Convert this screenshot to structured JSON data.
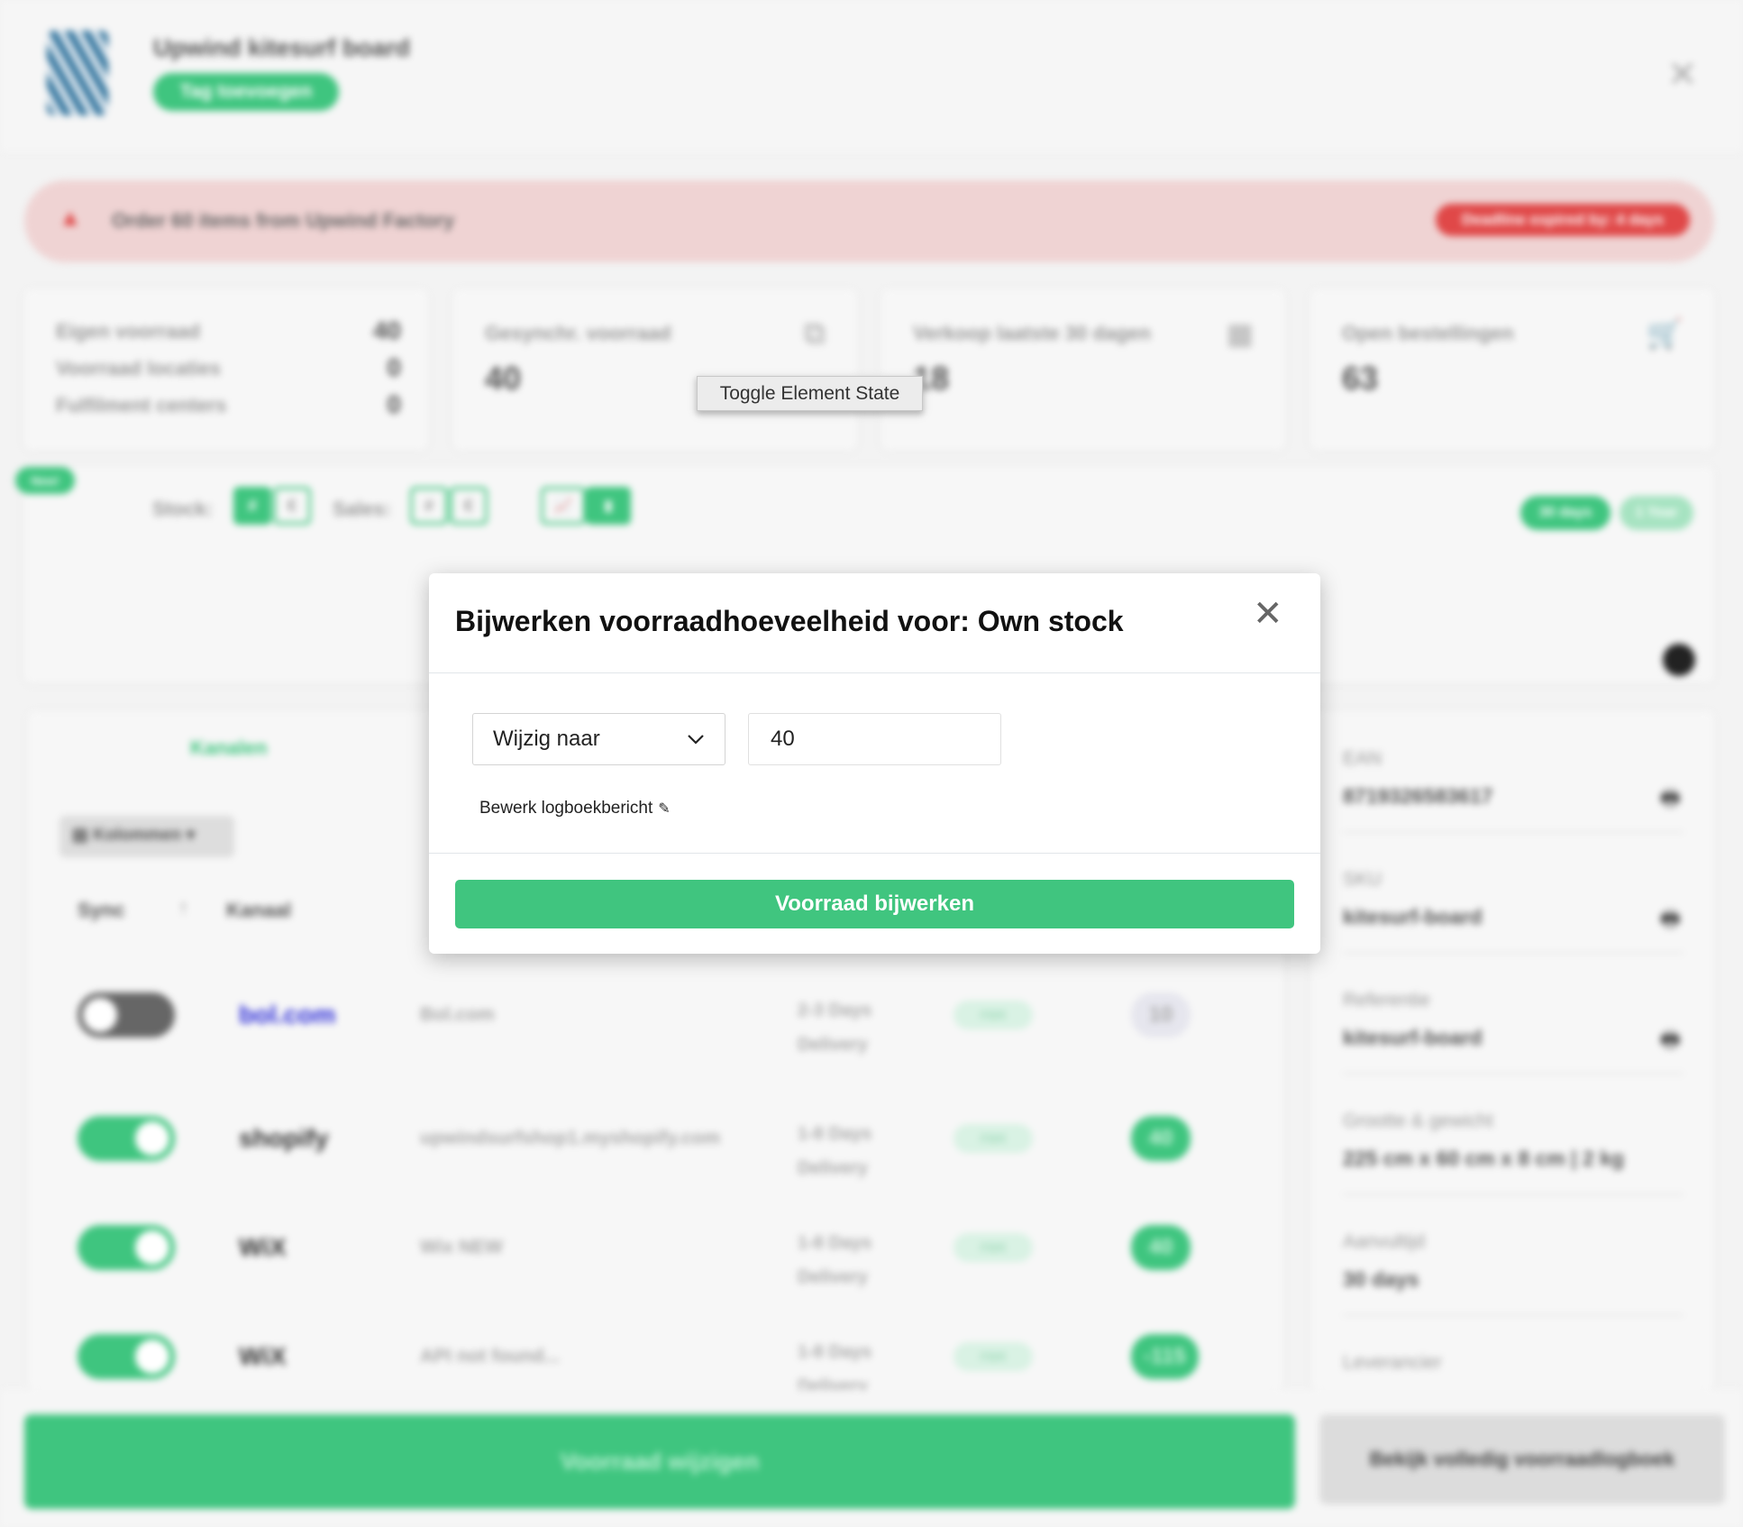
{
  "product": {
    "title": "Upwind kitesurf board",
    "tag_button": "Tag toevoegen"
  },
  "alert": {
    "text": "Order 60 items from Upwind Factory",
    "badge": "Deadline expired by: 4 days",
    "color": "#e04848"
  },
  "stats": {
    "own": [
      {
        "label": "Eigen voorraad",
        "value": "40"
      },
      {
        "label": "Voorraad locaties",
        "value": "0"
      },
      {
        "label": "Fulfilment centers",
        "value": "0"
      }
    ],
    "synced": {
      "label": "Gesynchr. voorraad",
      "value": "40"
    },
    "sales": {
      "label": "Verkoop laatste 30 dagen",
      "value": "18"
    },
    "orders": {
      "label": "Open bestellingen",
      "value": "63"
    }
  },
  "tooltip": "Toggle Element State",
  "chart_controls": {
    "new_badge": "New!",
    "stock_label": "Stock:",
    "sales_label": "Sales:",
    "hash": "#",
    "euro": "€",
    "range_30": "30 days",
    "range_1y": "1 Year"
  },
  "channels": {
    "tab": "Kanalen",
    "columns_button": "Kolommen",
    "headers": {
      "sync": "Sync",
      "kanaal": "Kanaal"
    },
    "rows": [
      {
        "sync": false,
        "logo": "bol.com",
        "name": "Bol.com",
        "delivery": "2-3 Days Delivery",
        "fbr": "FBR",
        "stock": "10"
      },
      {
        "sync": true,
        "logo": "shopify",
        "name": "upwindsurfshop1.myshopify.com",
        "delivery": "1-8 Days Delivery",
        "fbr": "FBR",
        "stock": "40"
      },
      {
        "sync": true,
        "logo": "WiX",
        "name": "Wix NEW",
        "delivery": "1-8 Days Delivery",
        "fbr": "FBR",
        "stock": "40"
      },
      {
        "sync": true,
        "logo": "WiX",
        "name": "API not found...",
        "delivery": "1-8 Days Delivery",
        "fbr": "FBR",
        "stock": "-115"
      }
    ]
  },
  "details": [
    {
      "label": "EAN",
      "value": "8719326583617"
    },
    {
      "label": "SKU",
      "value": "kitesurf-board"
    },
    {
      "label": "Referentie",
      "value": "kitesurf-board"
    },
    {
      "label": "Grootte & gewicht",
      "value": "225 cm x 60 cm x 8 cm | 2 kg"
    },
    {
      "label": "Aanvultijd",
      "value": "30 days"
    },
    {
      "label": "Leverancier",
      "value": ""
    }
  ],
  "footer": {
    "primary": "Voorraad wijzigen",
    "secondary": "Bekijk volledig voorraadlogboek"
  },
  "modal": {
    "title": "Bijwerken voorraadhoeveelheid voor: Own stock",
    "mode": "Wijzig naar",
    "quantity": "40",
    "log_link": "Bewerk logboekbericht",
    "submit": "Voorraad bijwerken",
    "accent": "#40c57f"
  }
}
